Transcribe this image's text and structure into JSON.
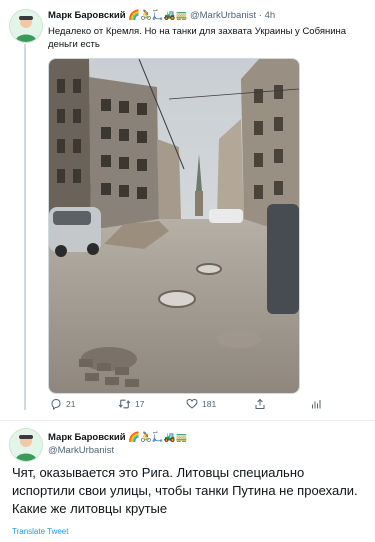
{
  "tweet1": {
    "author_name": "Марк Баровский",
    "author_badges": "🌈🚴🛴🚜🚃",
    "handle": "@MarkUrbanist",
    "separator": "·",
    "time": "4h",
    "text": "Недалеко от Кремля. Но на танки для захвата Украины у Собянина деньги есть",
    "photo_icon": "street-photo-potholes",
    "actions": {
      "reply_count": "21",
      "retweet_count": "17",
      "like_count": "181"
    }
  },
  "tweet2": {
    "author_name": "Марк Баровский",
    "author_badges": "🌈🚴🛴🚜🚃",
    "handle": "@MarkUrbanist",
    "text": "Чят, оказывается это Рига. Литовцы специально испортили свои улицы, чтобы танки Путина не проехали. Какие же литовцы крутые",
    "translate_label": "Translate Tweet"
  },
  "colors": {
    "link": "#1d9bf0",
    "muted": "#536471",
    "thread_line": "#cfd9de"
  }
}
